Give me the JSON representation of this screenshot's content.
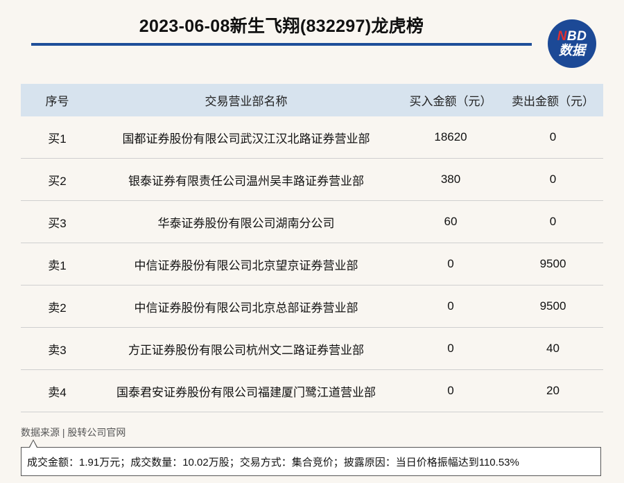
{
  "title": "2023-06-08新生飞翔(832297)龙虎榜",
  "logo": {
    "n": "N",
    "bd": "BD",
    "line2": "数据"
  },
  "headers": [
    "序号",
    "交易营业部名称",
    "买入金额（元）",
    "卖出金额（元）"
  ],
  "rows": [
    {
      "seq": "买1",
      "name": "国都证券股份有限公司武汉江汉北路证券营业部",
      "buy": "18620",
      "sell": "0"
    },
    {
      "seq": "买2",
      "name": "银泰证券有限责任公司温州吴丰路证券营业部",
      "buy": "380",
      "sell": "0"
    },
    {
      "seq": "买3",
      "name": "华泰证券股份有限公司湖南分公司",
      "buy": "60",
      "sell": "0"
    },
    {
      "seq": "卖1",
      "name": "中信证券股份有限公司北京望京证券营业部",
      "buy": "0",
      "sell": "9500"
    },
    {
      "seq": "卖2",
      "name": "中信证券股份有限公司北京总部证券营业部",
      "buy": "0",
      "sell": "9500"
    },
    {
      "seq": "卖3",
      "name": "方正证券股份有限公司杭州文二路证券营业部",
      "buy": "0",
      "sell": "40"
    },
    {
      "seq": "卖4",
      "name": "国泰君安证券股份有限公司福建厦门鹭江道营业部",
      "buy": "0",
      "sell": "20"
    }
  ],
  "source": "数据来源 | 股转公司官网",
  "summary": "成交金额：1.91万元；成交数量：10.02万股；交易方式：集合竞价；披露原因：当日价格振幅达到110.53%",
  "colors": {
    "accent": "#1f4f99",
    "header_bg": "#d7e3ee",
    "logo_red": "#e3302f"
  }
}
